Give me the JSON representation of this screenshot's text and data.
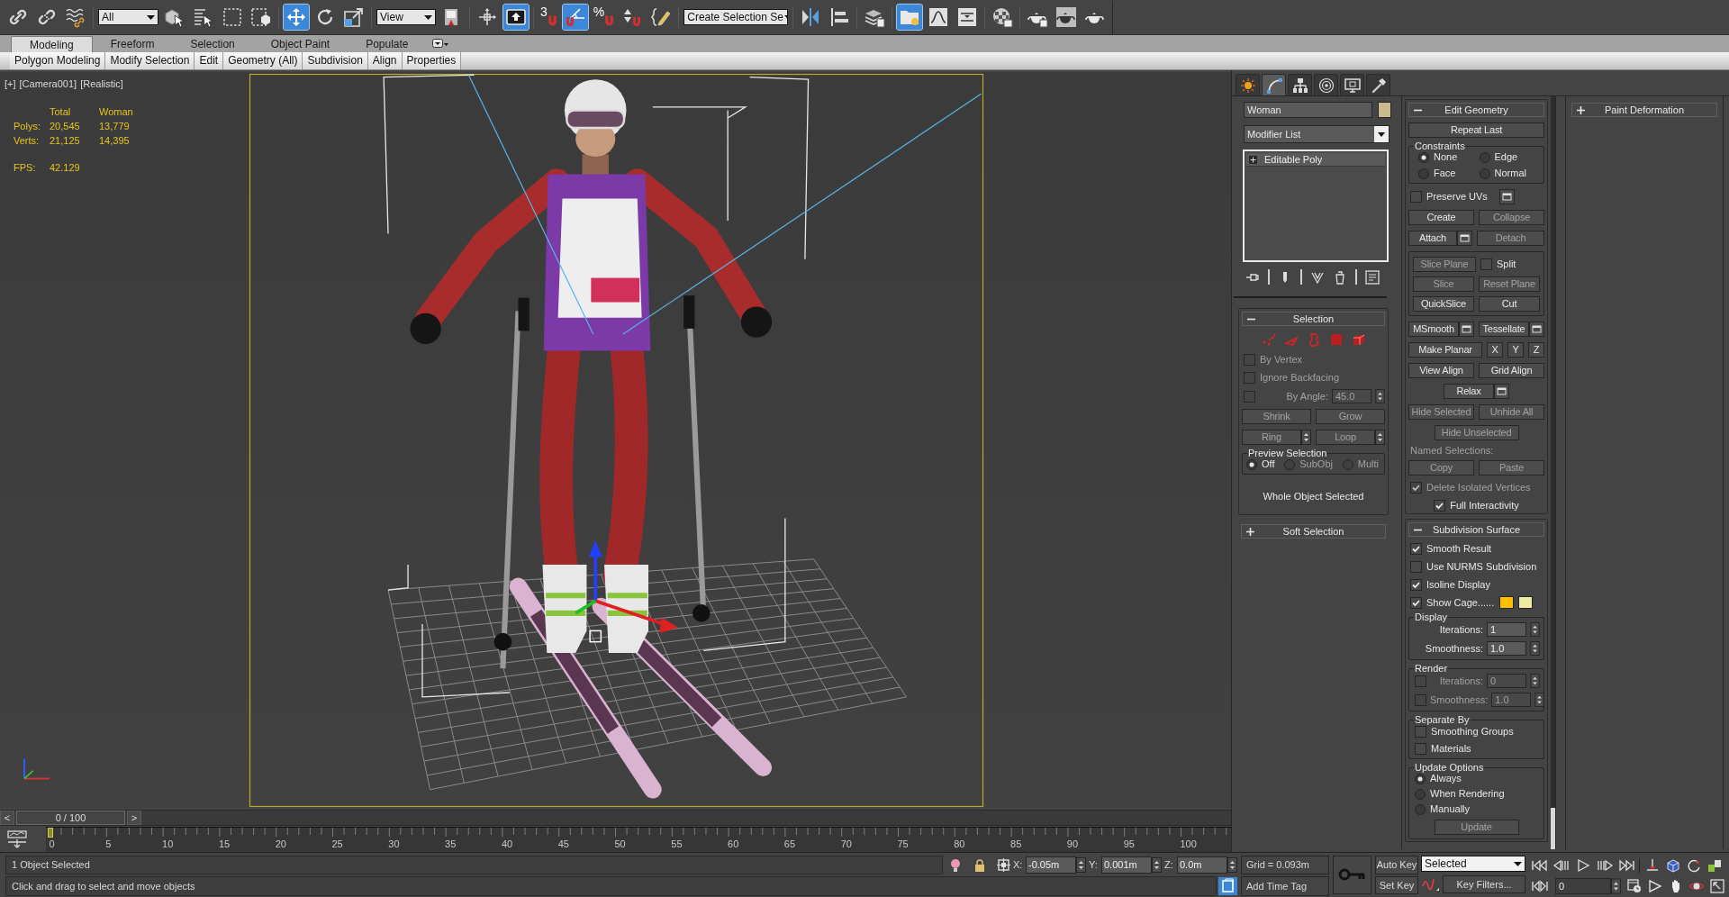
{
  "main_toolbar": [
    {
      "kind": "icon",
      "selected": false
    },
    {
      "kind": "icon",
      "selected": false
    },
    {
      "kind": "icon",
      "selected": false
    },
    {
      "kind": "dropdown",
      "value": "All"
    },
    {
      "kind": "icon",
      "selected": false
    },
    {
      "kind": "icon",
      "selected": false
    },
    {
      "kind": "icon",
      "selected": false
    },
    {
      "kind": "icon",
      "selected": false
    },
    {
      "kind": "icon",
      "selected": true
    },
    {
      "kind": "icon",
      "selected": false
    },
    {
      "kind": "icon",
      "selected": false
    },
    {
      "kind": "dropdown",
      "value": "View"
    },
    {
      "kind": "icon",
      "selected": false
    },
    {
      "kind": "icon",
      "selected": false
    },
    {
      "kind": "icon",
      "selected": true
    },
    {
      "kind": "snap",
      "label": "3",
      "selected": false
    },
    {
      "kind": "icon",
      "selected": true
    },
    {
      "kind": "snap",
      "label": "%",
      "selected": false
    },
    {
      "kind": "icon",
      "selected": false
    },
    {
      "kind": "icon",
      "selected": false
    },
    {
      "kind": "dropdown",
      "value": "Create Selection Se"
    },
    {
      "kind": "icon",
      "selected": false
    },
    {
      "kind": "icon",
      "selected": false
    },
    {
      "kind": "icon",
      "selected": false
    },
    {
      "kind": "icon",
      "selected": true
    },
    {
      "kind": "icon",
      "selected": false
    },
    {
      "kind": "icon",
      "selected": false
    },
    {
      "kind": "icon",
      "selected": false
    },
    {
      "kind": "icon",
      "selected": false
    },
    {
      "kind": "icon",
      "selected": false
    },
    {
      "kind": "icon",
      "selected": false
    }
  ],
  "ribbon": {
    "tabs": [
      {
        "label": "Modeling",
        "selected": true
      },
      {
        "label": "Freeform",
        "selected": false
      },
      {
        "label": "Selection",
        "selected": false
      },
      {
        "label": "Object Paint",
        "selected": false
      },
      {
        "label": "Populate",
        "selected": false
      }
    ],
    "panels": [
      "Polygon Modeling",
      "Modify Selection",
      "Edit",
      "Geometry (All)",
      "Subdivision",
      "Align",
      "Properties"
    ]
  },
  "viewport": {
    "labels": [
      "[+]",
      "[Camera001]",
      "[Realistic]"
    ],
    "stats": {
      "columns": [
        "Total",
        "Woman"
      ],
      "rows": [
        {
          "label": "Polys:",
          "values": [
            "20,545",
            "13,779"
          ]
        },
        {
          "label": "Verts:",
          "values": [
            "21,125",
            "14,395"
          ]
        }
      ],
      "fps": {
        "label": "FPS:",
        "value": "42.129"
      }
    }
  },
  "command_panel": {
    "tabs": [
      {
        "selected": false
      },
      {
        "selected": true
      },
      {
        "selected": false
      },
      {
        "selected": false
      },
      {
        "selected": false
      },
      {
        "selected": false
      }
    ],
    "object_name": "Woman",
    "modifier_list": "Modifier List",
    "modifier_stack": [
      {
        "label": "Editable Poly",
        "expanded": false
      }
    ],
    "left_rollouts": [
      {
        "title": "Selection",
        "expanded": true,
        "rows": [
          {
            "kind": "subobject_icons"
          },
          {
            "kind": "checkbox",
            "label": "By Vertex",
            "checked": false,
            "disabled": true
          },
          {
            "kind": "checkbox",
            "label": "Ignore Backfacing",
            "checked": false,
            "disabled": true
          },
          {
            "kind": "check_spinner",
            "label": "By Angle:",
            "value": "45.0",
            "checked": false,
            "disabled": true
          },
          {
            "kind": "buttons",
            "items": [
              {
                "label": "Shrink",
                "disabled": true
              },
              {
                "label": "Grow",
                "disabled": true
              }
            ]
          },
          {
            "kind": "buttons",
            "items": [
              {
                "label": "Ring",
                "disabled": true,
                "spinner": true
              },
              {
                "label": "Loop",
                "disabled": true,
                "spinner": true
              }
            ]
          },
          {
            "kind": "group",
            "title": "Preview Selection",
            "rows": [
              {
                "kind": "radio_row",
                "items": [
                  {
                    "label": "Off",
                    "selected": true,
                    "disabled": false
                  },
                  {
                    "label": "SubObj",
                    "selected": false,
                    "disabled": true
                  },
                  {
                    "label": "Multi",
                    "selected": false,
                    "disabled": true
                  }
                ]
              }
            ]
          },
          {
            "kind": "note",
            "text": "Whole Object Selected"
          }
        ]
      },
      {
        "title": "Soft Selection",
        "expanded": false
      }
    ],
    "middle_rollouts": [
      {
        "title": "Edit Geometry",
        "expanded": true,
        "rows": [
          {
            "kind": "buttons",
            "items": [
              {
                "label": "Repeat Last",
                "disabled": false
              }
            ]
          },
          {
            "kind": "group",
            "title": "Constraints",
            "rows": [
              {
                "kind": "radio_grid",
                "items": [
                  {
                    "label": "None",
                    "selected": true,
                    "disabled": false
                  },
                  {
                    "label": "Edge",
                    "selected": false,
                    "disabled": false
                  },
                  {
                    "label": "Face",
                    "selected": false,
                    "disabled": false
                  },
                  {
                    "label": "Normal",
                    "selected": false,
                    "disabled": false
                  }
                ]
              }
            ]
          },
          {
            "kind": "checkbox",
            "label": "Preserve UVs",
            "checked": false,
            "disabled": false,
            "settings": true
          },
          {
            "kind": "buttons",
            "items": [
              {
                "label": "Create",
                "disabled": false
              },
              {
                "label": "Collapse",
                "disabled": true
              }
            ]
          },
          {
            "kind": "buttons",
            "items": [
              {
                "label": "Attach",
                "disabled": false,
                "settings": true
              },
              {
                "label": "Detach",
                "disabled": true
              }
            ]
          },
          {
            "kind": "group",
            "rows": [
              {
                "kind": "button_checkbox",
                "button": {
                  "label": "Slice Plane",
                  "disabled": true
                },
                "checkbox": {
                  "label": "Split",
                  "checked": false,
                  "disabled": false
                }
              },
              {
                "kind": "buttons",
                "items": [
                  {
                    "label": "Slice",
                    "disabled": true
                  },
                  {
                    "label": "Reset Plane",
                    "disabled": true
                  }
                ]
              },
              {
                "kind": "buttons",
                "items": [
                  {
                    "label": "QuickSlice",
                    "disabled": false
                  },
                  {
                    "label": "Cut",
                    "disabled": false
                  }
                ]
              }
            ]
          },
          {
            "kind": "buttons",
            "items": [
              {
                "label": "MSmooth",
                "disabled": false,
                "settings": true
              },
              {
                "label": "Tessellate",
                "disabled": false,
                "settings": true
              }
            ]
          },
          {
            "kind": "buttons",
            "items": [
              {
                "label": "Make Planar",
                "disabled": false
              },
              {
                "label": "X",
                "disabled": false
              },
              {
                "label": "Y",
                "disabled": false
              },
              {
                "label": "Z",
                "disabled": false
              }
            ]
          },
          {
            "kind": "buttons",
            "items": [
              {
                "label": "View Align",
                "disabled": false
              },
              {
                "label": "Grid Align",
                "disabled": false
              }
            ]
          },
          {
            "kind": "centered_button",
            "label": "Relax",
            "disabled": false,
            "settings": true
          },
          {
            "kind": "buttons",
            "items": [
              {
                "label": "Hide Selected",
                "disabled": true
              },
              {
                "label": "Unhide All",
                "disabled": true
              }
            ]
          },
          {
            "kind": "centered_button",
            "label": "Hide Unselected",
            "disabled": true
          },
          {
            "kind": "label",
            "text": "Named Selections:",
            "disabled": true
          },
          {
            "kind": "buttons",
            "items": [
              {
                "label": "Copy",
                "disabled": true
              },
              {
                "label": "Paste",
                "disabled": true
              }
            ]
          },
          {
            "kind": "checkbox",
            "label": "Delete Isolated Vertices",
            "checked": true,
            "disabled": true
          },
          {
            "kind": "centered_checkbox",
            "label": "Full Interactivity",
            "checked": true,
            "disabled": false
          }
        ]
      },
      {
        "title": "Subdivision Surface",
        "expanded": true,
        "rows": [
          {
            "kind": "checkbox",
            "label": "Smooth Result",
            "checked": true,
            "disabled": false
          },
          {
            "kind": "checkbox",
            "label": "Use NURMS Subdivision",
            "checked": false,
            "disabled": false
          },
          {
            "kind": "checkbox",
            "label": "Isoline Display",
            "checked": true,
            "disabled": false
          },
          {
            "kind": "checkbox",
            "label": "Show Cage......",
            "checked": true,
            "disabled": false,
            "swatches": [
              {
                "color": "#ffc000"
              },
              {
                "color": "#eeeaa2"
              }
            ]
          },
          {
            "kind": "group",
            "title": "Display",
            "rows": [
              {
                "kind": "spinner",
                "label": "Iterations:",
                "value": "1",
                "disabled": false
              },
              {
                "kind": "spinner",
                "label": "Smoothness:",
                "value": "1.0",
                "disabled": false
              }
            ]
          },
          {
            "kind": "group",
            "title": "Render",
            "rows": [
              {
                "kind": "check_spinner",
                "label": "Iterations:",
                "value": "0",
                "checked": false,
                "disabled": true
              },
              {
                "kind": "check_spinner",
                "label": "Smoothness:",
                "value": "1.0",
                "checked": false,
                "disabled": true
              }
            ]
          },
          {
            "kind": "group",
            "title": "Separate By",
            "rows": [
              {
                "kind": "checkbox",
                "label": "Smoothing Groups",
                "checked": false,
                "disabled": false
              },
              {
                "kind": "checkbox",
                "label": "Materials",
                "checked": false,
                "disabled": false
              }
            ]
          },
          {
            "kind": "group",
            "title": "Update Options",
            "rows": [
              {
                "kind": "radio_list",
                "items": [
                  {
                    "label": "Always",
                    "selected": true,
                    "disabled": false
                  },
                  {
                    "label": "When Rendering",
                    "selected": false,
                    "disabled": false
                  },
                  {
                    "label": "Manually",
                    "selected": false,
                    "disabled": false
                  }
                ]
              },
              {
                "kind": "centered_button",
                "label": "Update",
                "disabled": true
              }
            ]
          }
        ]
      }
    ],
    "right_rollouts": [
      {
        "title": "Paint Deformation",
        "expanded": false
      }
    ]
  },
  "timeline": {
    "prev": "<",
    "thumb_label": "0 / 100",
    "next": ">",
    "level": 0,
    "ticks": [
      "0",
      "5",
      "10",
      "15",
      "20",
      "25",
      "30",
      "35",
      "40",
      "45",
      "50",
      "55",
      "60",
      "65",
      "70",
      "75",
      "80",
      "85",
      "90",
      "95",
      "100"
    ]
  },
  "status_bar": {
    "selection_info": "1 Object Selected",
    "prompt": "Click and drag to select and move objects",
    "coords": [
      {
        "axis": "X:",
        "value": "-0.05m"
      },
      {
        "axis": "Y:",
        "value": "0.001m"
      },
      {
        "axis": "Z:",
        "value": "0.0m"
      }
    ],
    "grid": "Grid = 0.093m",
    "time_tag": "Add Time Tag"
  },
  "animation_controls": {
    "auto_key": "Auto Key",
    "set_key": "Set Key",
    "key_set": "Selected",
    "key_filters": "Key Filters...",
    "frame": "0"
  }
}
